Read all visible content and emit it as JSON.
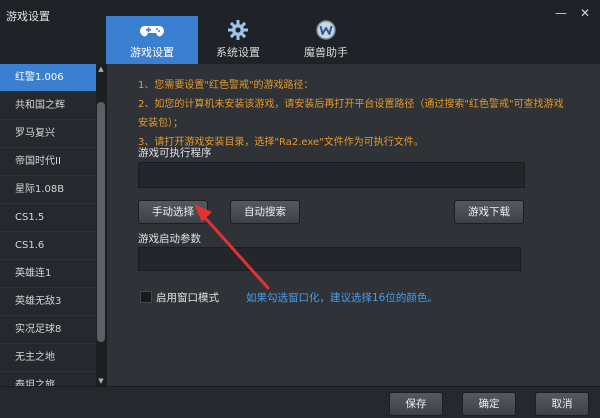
{
  "window": {
    "title": "游戏设置",
    "minimize_glyph": "—",
    "close_glyph": "✕"
  },
  "tabs": [
    {
      "label": "游戏设置",
      "icon": "gamepad-icon",
      "active": true
    },
    {
      "label": "系统设置",
      "icon": "gear-icon",
      "active": false
    },
    {
      "label": "魔兽助手",
      "icon": "warcraft-w-icon",
      "active": false
    }
  ],
  "sidebar": {
    "items": [
      {
        "label": "红警1.006",
        "selected": true
      },
      {
        "label": "共和国之辉",
        "selected": false
      },
      {
        "label": "罗马复兴",
        "selected": false
      },
      {
        "label": "帝国时代II",
        "selected": false
      },
      {
        "label": "星际1.08B",
        "selected": false
      },
      {
        "label": "CS1.5",
        "selected": false
      },
      {
        "label": "CS1.6",
        "selected": false
      },
      {
        "label": "英雄连1",
        "selected": false
      },
      {
        "label": "英雄无敌3",
        "selected": false
      },
      {
        "label": "实况足球8",
        "selected": false
      },
      {
        "label": "无主之地",
        "selected": false
      },
      {
        "label": "泰坦之旅",
        "selected": false
      }
    ]
  },
  "instructions": [
    "1、您需要设置\"红色警戒\"的游戏路径：",
    "2、如您的计算机未安装该游戏，请安装后再打开平台设置路径（通过搜索\"红色警戒\"可查找游戏安装包）；",
    "3、请打开游戏安装目录，选择\"Ra2.exe\"文件作为可执行文件。"
  ],
  "exe_section": {
    "label": "游戏可执行程序",
    "value": ""
  },
  "buttons": {
    "manual": "手动选择",
    "auto": "自动搜索",
    "download": "游戏下载"
  },
  "args_section": {
    "label": "游戏启动参数",
    "value": ""
  },
  "window_mode": {
    "label": "启用窗口模式",
    "checked": false,
    "hint": "如果勾选窗口化，建议选择16位的颜色。"
  },
  "footer": {
    "save": "保存",
    "ok": "确定",
    "cancel": "取消"
  },
  "colors": {
    "accent": "#3a7fd0",
    "instruction_text": "#e59a2a",
    "hint_text": "#4a9be8",
    "arrow": "#e23232"
  }
}
